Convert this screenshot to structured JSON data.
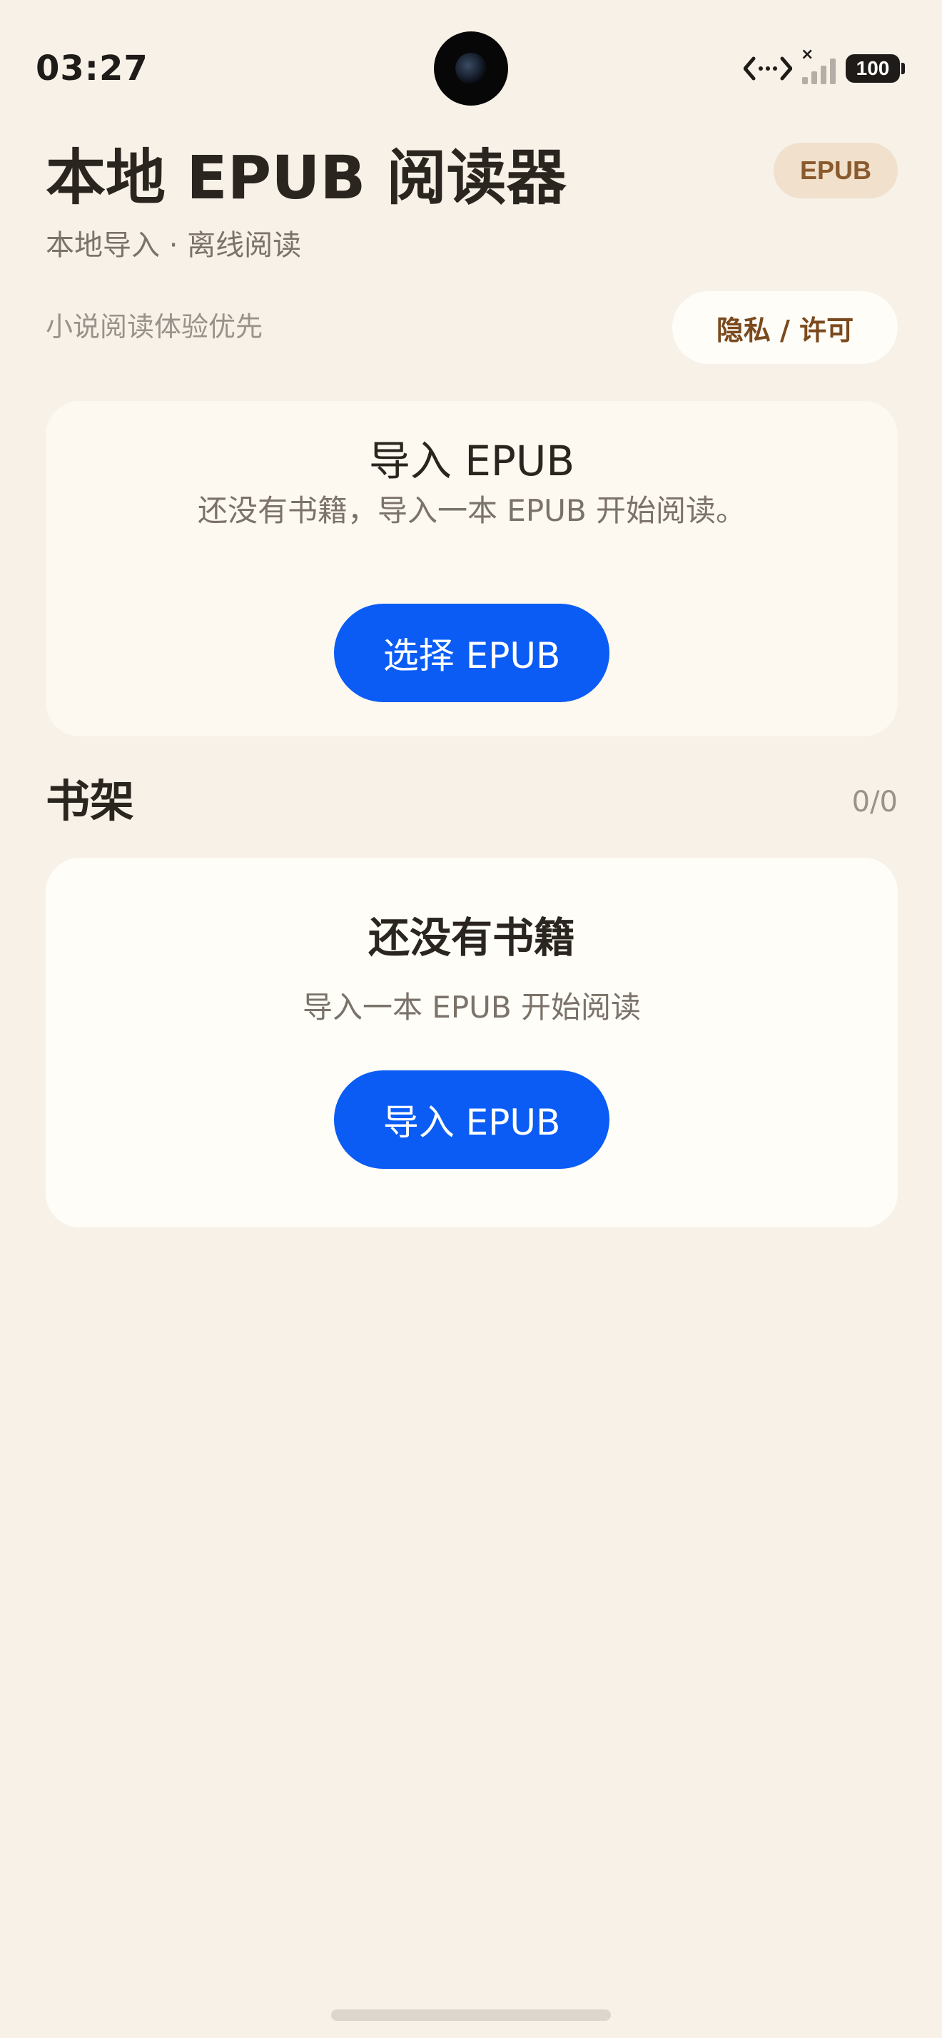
{
  "status_bar": {
    "time": "03:27",
    "battery": "100"
  },
  "header": {
    "title": "本地 EPUB 阅读器",
    "badge": "EPUB",
    "subtitle": "本地导入 · 离线阅读",
    "tagline": "小说阅读体验优先",
    "privacy_button": "隐私 / 许可"
  },
  "import_card": {
    "title": "导入 EPUB",
    "text": "还没有书籍，导入一本 EPUB 开始阅读。",
    "button": "选择 EPUB"
  },
  "shelf": {
    "title": "书架",
    "count": "0/0",
    "empty_title": "还没有书籍",
    "empty_text": "导入一本 EPUB 开始阅读",
    "button": "导入 EPUB"
  },
  "colors": {
    "background": "#f7f1e8",
    "accent": "#0a5cf5",
    "badge_bg": "#f0e0cc",
    "badge_text": "#8a5a2e"
  },
  "icons": [
    "data-transfer-icon",
    "signal-icon",
    "battery-icon",
    "camera-cutout"
  ]
}
